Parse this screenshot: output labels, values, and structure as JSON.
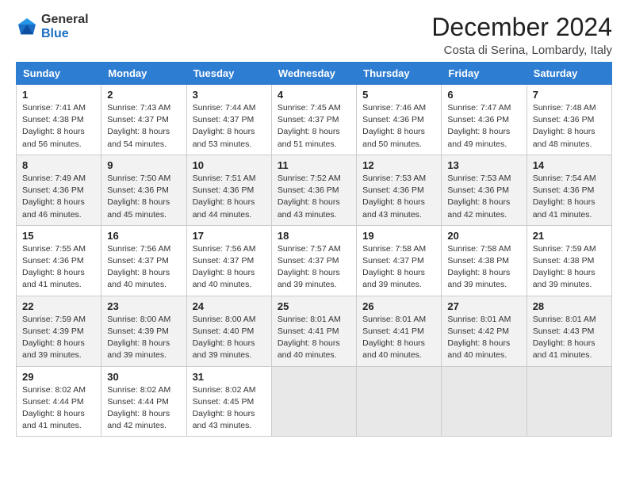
{
  "logo": {
    "line1": "General",
    "line2": "Blue"
  },
  "title": "December 2024",
  "subtitle": "Costa di Serina, Lombardy, Italy",
  "weekdays": [
    "Sunday",
    "Monday",
    "Tuesday",
    "Wednesday",
    "Thursday",
    "Friday",
    "Saturday"
  ],
  "weeks": [
    [
      {
        "day": "1",
        "sunrise": "7:41 AM",
        "sunset": "4:38 PM",
        "daylight": "8 hours and 56 minutes."
      },
      {
        "day": "2",
        "sunrise": "7:43 AM",
        "sunset": "4:37 PM",
        "daylight": "8 hours and 54 minutes."
      },
      {
        "day": "3",
        "sunrise": "7:44 AM",
        "sunset": "4:37 PM",
        "daylight": "8 hours and 53 minutes."
      },
      {
        "day": "4",
        "sunrise": "7:45 AM",
        "sunset": "4:37 PM",
        "daylight": "8 hours and 51 minutes."
      },
      {
        "day": "5",
        "sunrise": "7:46 AM",
        "sunset": "4:36 PM",
        "daylight": "8 hours and 50 minutes."
      },
      {
        "day": "6",
        "sunrise": "7:47 AM",
        "sunset": "4:36 PM",
        "daylight": "8 hours and 49 minutes."
      },
      {
        "day": "7",
        "sunrise": "7:48 AM",
        "sunset": "4:36 PM",
        "daylight": "8 hours and 48 minutes."
      }
    ],
    [
      {
        "day": "8",
        "sunrise": "7:49 AM",
        "sunset": "4:36 PM",
        "daylight": "8 hours and 46 minutes."
      },
      {
        "day": "9",
        "sunrise": "7:50 AM",
        "sunset": "4:36 PM",
        "daylight": "8 hours and 45 minutes."
      },
      {
        "day": "10",
        "sunrise": "7:51 AM",
        "sunset": "4:36 PM",
        "daylight": "8 hours and 44 minutes."
      },
      {
        "day": "11",
        "sunrise": "7:52 AM",
        "sunset": "4:36 PM",
        "daylight": "8 hours and 43 minutes."
      },
      {
        "day": "12",
        "sunrise": "7:53 AM",
        "sunset": "4:36 PM",
        "daylight": "8 hours and 43 minutes."
      },
      {
        "day": "13",
        "sunrise": "7:53 AM",
        "sunset": "4:36 PM",
        "daylight": "8 hours and 42 minutes."
      },
      {
        "day": "14",
        "sunrise": "7:54 AM",
        "sunset": "4:36 PM",
        "daylight": "8 hours and 41 minutes."
      }
    ],
    [
      {
        "day": "15",
        "sunrise": "7:55 AM",
        "sunset": "4:36 PM",
        "daylight": "8 hours and 41 minutes."
      },
      {
        "day": "16",
        "sunrise": "7:56 AM",
        "sunset": "4:37 PM",
        "daylight": "8 hours and 40 minutes."
      },
      {
        "day": "17",
        "sunrise": "7:56 AM",
        "sunset": "4:37 PM",
        "daylight": "8 hours and 40 minutes."
      },
      {
        "day": "18",
        "sunrise": "7:57 AM",
        "sunset": "4:37 PM",
        "daylight": "8 hours and 39 minutes."
      },
      {
        "day": "19",
        "sunrise": "7:58 AM",
        "sunset": "4:37 PM",
        "daylight": "8 hours and 39 minutes."
      },
      {
        "day": "20",
        "sunrise": "7:58 AM",
        "sunset": "4:38 PM",
        "daylight": "8 hours and 39 minutes."
      },
      {
        "day": "21",
        "sunrise": "7:59 AM",
        "sunset": "4:38 PM",
        "daylight": "8 hours and 39 minutes."
      }
    ],
    [
      {
        "day": "22",
        "sunrise": "7:59 AM",
        "sunset": "4:39 PM",
        "daylight": "8 hours and 39 minutes."
      },
      {
        "day": "23",
        "sunrise": "8:00 AM",
        "sunset": "4:39 PM",
        "daylight": "8 hours and 39 minutes."
      },
      {
        "day": "24",
        "sunrise": "8:00 AM",
        "sunset": "4:40 PM",
        "daylight": "8 hours and 39 minutes."
      },
      {
        "day": "25",
        "sunrise": "8:01 AM",
        "sunset": "4:41 PM",
        "daylight": "8 hours and 40 minutes."
      },
      {
        "day": "26",
        "sunrise": "8:01 AM",
        "sunset": "4:41 PM",
        "daylight": "8 hours and 40 minutes."
      },
      {
        "day": "27",
        "sunrise": "8:01 AM",
        "sunset": "4:42 PM",
        "daylight": "8 hours and 40 minutes."
      },
      {
        "day": "28",
        "sunrise": "8:01 AM",
        "sunset": "4:43 PM",
        "daylight": "8 hours and 41 minutes."
      }
    ],
    [
      {
        "day": "29",
        "sunrise": "8:02 AM",
        "sunset": "4:44 PM",
        "daylight": "8 hours and 41 minutes."
      },
      {
        "day": "30",
        "sunrise": "8:02 AM",
        "sunset": "4:44 PM",
        "daylight": "8 hours and 42 minutes."
      },
      {
        "day": "31",
        "sunrise": "8:02 AM",
        "sunset": "4:45 PM",
        "daylight": "8 hours and 43 minutes."
      },
      null,
      null,
      null,
      null
    ]
  ],
  "labels": {
    "sunrise": "Sunrise:",
    "sunset": "Sunset:",
    "daylight": "Daylight:"
  }
}
